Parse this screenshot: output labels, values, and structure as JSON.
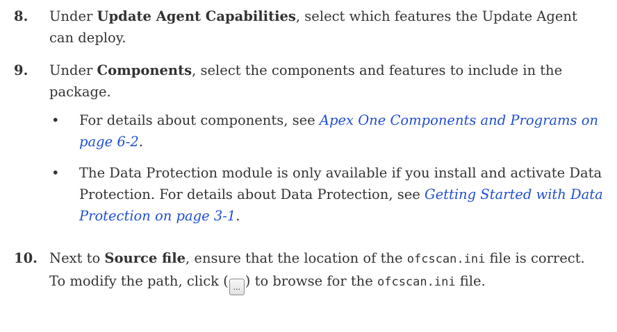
{
  "steps": [
    {
      "number": "8.",
      "prefix": "Under ",
      "bold": "Update Agent Capabilities",
      "suffix": ", select which features the Update Agent can deploy."
    },
    {
      "number": "9.",
      "prefix": "Under ",
      "bold": "Components",
      "suffix": ", select the components and features to include in the package.",
      "bullets": [
        {
          "symbol": "•",
          "before": "For details about components, see ",
          "link": "Apex One Components and Programs on page 6-2",
          "after": "."
        },
        {
          "symbol": "•",
          "before": "The Data Protection module is only available if you install and activate Data Protection. For details about Data Protection, see ",
          "link": "Getting Started with Data Protection on page 3-1",
          "after": "."
        }
      ]
    },
    {
      "number": "10.",
      "prefix": "Next to ",
      "bold": "Source file",
      "mid1": ", ensure that the location of the ",
      "code1": "ofcscan.ini",
      "mid2": " file is correct. To modify the path, click (",
      "button_label": "...",
      "mid3": ") to browse for the ",
      "code2": "ofcscan.ini",
      "suffix": " file."
    }
  ]
}
